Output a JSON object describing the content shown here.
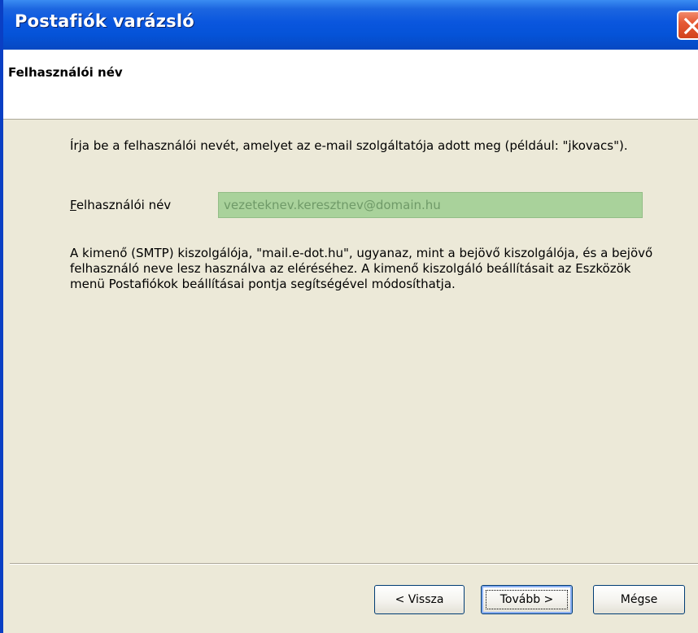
{
  "window": {
    "title": "Postafiók varázsló"
  },
  "header": {
    "title": "Felhasználói név"
  },
  "main": {
    "intro_text": "Írja be a felhasználói nevét, amelyet az e-mail szolgáltatója adott meg (például: \"jkovacs\").",
    "username_label_mnemonic": "F",
    "username_label_rest": "elhasználói név",
    "username_value": "vezeteknev.keresztnev@domain.hu",
    "info_text": "A kimenő (SMTP) kiszolgálója, \"mail.e-dot.hu\", ugyanaz, mint a bejövő kiszolgálója, és a bejövő felhasználó neve lesz használva az eléréséhez. A kimenő kiszolgáló beállításait az Eszközök menü Postafiókok beállításai pontja segítségével módosíthatja."
  },
  "buttons": {
    "back": "< Vissza",
    "next": "Tovább >",
    "cancel": "Mégse"
  },
  "icons": {
    "close": "close-icon"
  },
  "colors": {
    "titlebar": "#0553d8",
    "dialog_background": "#ece9d8",
    "input_background": "#a9d29b",
    "input_text": "#6f9a68",
    "close_button": "#e65a35"
  }
}
